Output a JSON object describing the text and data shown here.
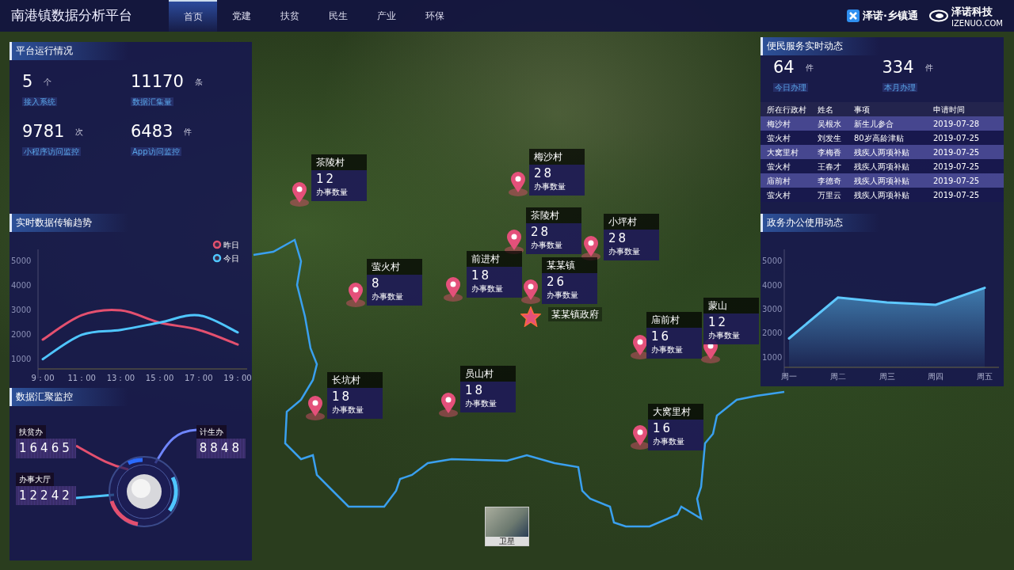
{
  "header": {
    "title": "南港镇数据分析平台",
    "tabs": [
      {
        "label": "首页",
        "selected": true
      },
      {
        "label": "党建",
        "selected": false
      },
      {
        "label": "扶贫",
        "selected": false
      },
      {
        "label": "民生",
        "selected": false
      },
      {
        "label": "产业",
        "selected": false
      },
      {
        "label": "环保",
        "selected": false
      }
    ],
    "logos": [
      {
        "kind": "product",
        "text": "泽诺·乡镇通"
      },
      {
        "kind": "company",
        "text": "泽诺科技",
        "subtext": "IZENUO.COM"
      }
    ]
  },
  "left_panel": {
    "platform": {
      "title": "平台运行情况",
      "stats": [
        {
          "value": "5",
          "unit": "个",
          "label": "接入系统"
        },
        {
          "value": "11170",
          "unit": "条",
          "label": "数据汇集量"
        },
        {
          "value": "9781",
          "unit": "次",
          "label": "小程序访问监控"
        },
        {
          "value": "6483",
          "unit": "件",
          "label": "App访问监控"
        }
      ]
    },
    "trend": {
      "title": "实时数据传输趋势",
      "chart_data": {
        "type": "line",
        "legend": "top-right",
        "categories": [
          "9：00",
          "11：00",
          "13：00",
          "15：00",
          "17：00",
          "19：00"
        ],
        "ylim": [
          600,
          5500
        ],
        "yticks": [
          1000,
          2000,
          3000,
          4000,
          5000
        ],
        "series": [
          {
            "name": "昨日",
            "color": "#e4506f",
            "values": [
              1800,
              2800,
              3000,
              2500,
              2200,
              1600
            ]
          },
          {
            "name": "今日",
            "color": "#4fc6ff",
            "values": [
              1000,
              2000,
              2200,
              2500,
              2800,
              2100
            ]
          }
        ]
      }
    },
    "monitor": {
      "title": "数据汇聚监控",
      "counters": [
        {
          "label": "扶贫办",
          "value": "16465"
        },
        {
          "label": "计生办",
          "value": "8848"
        },
        {
          "label": "办事大厅",
          "value": "12242"
        }
      ]
    }
  },
  "right_panel": {
    "service": {
      "title": "便民服务实时动态",
      "stats": [
        {
          "value": "64",
          "unit": "件",
          "label": "今日办理"
        },
        {
          "value": "334",
          "unit": "件",
          "label": "本月办理"
        }
      ],
      "table": {
        "columns": [
          "所在行政村",
          "姓名",
          "事项",
          "申请时间"
        ],
        "rows": [
          [
            "梅沙村",
            "吴根水",
            "新生儿参合",
            "2019-07-28"
          ],
          [
            "萤火村",
            "刘发生",
            "80岁高龄津贴",
            "2019-07-25"
          ],
          [
            "大窝里村",
            "李梅香",
            "残疾人两项补贴",
            "2019-07-25"
          ],
          [
            "萤火村",
            "王春才",
            "残疾人两项补贴",
            "2019-07-25"
          ],
          [
            "庙前村",
            "李德奇",
            "残疾人两项补贴",
            "2019-07-25"
          ],
          [
            "萤火村",
            "万里云",
            "残疾人两项补贴",
            "2019-07-25"
          ]
        ]
      }
    },
    "office": {
      "title": "政务办公使用动态",
      "chart_data": {
        "type": "area",
        "categories": [
          "周一",
          "周二",
          "周三",
          "周四",
          "周五"
        ],
        "ylim": [
          600,
          5500
        ],
        "yticks": [
          1000,
          2000,
          3000,
          4000,
          5000
        ],
        "series": [
          {
            "color": "#5ec8ff",
            "values": [
              1800,
              3500,
              3300,
              3200,
              3900
            ]
          }
        ]
      }
    }
  },
  "map": {
    "markers": [
      {
        "name": "茶陵村",
        "count": "12",
        "caption": "办事数量"
      },
      {
        "name": "梅沙村",
        "count": "28",
        "caption": "办事数量"
      },
      {
        "name": "茶陵村",
        "count": "28",
        "caption": "办事数量"
      },
      {
        "name": "小坪村",
        "count": "28",
        "caption": "办事数量"
      },
      {
        "name": "萤火村",
        "count": "8",
        "caption": "办事数量"
      },
      {
        "name": "前进村",
        "count": "18",
        "caption": "办事数量"
      },
      {
        "name": "某某镇",
        "count": "26",
        "caption": "办事数量"
      },
      {
        "name": "蒙山",
        "count": "12",
        "caption": "办事数量"
      },
      {
        "name": "庙前村",
        "count": "16",
        "caption": "办事数量"
      },
      {
        "name": "长坑村",
        "count": "18",
        "caption": "办事数量"
      },
      {
        "name": "员山村",
        "count": "18",
        "caption": "办事数量"
      },
      {
        "name": "大窝里村",
        "count": "16",
        "caption": "办事数量"
      }
    ],
    "government": {
      "label": "某某镇政府"
    },
    "layer_button": {
      "label": "卫星"
    }
  }
}
